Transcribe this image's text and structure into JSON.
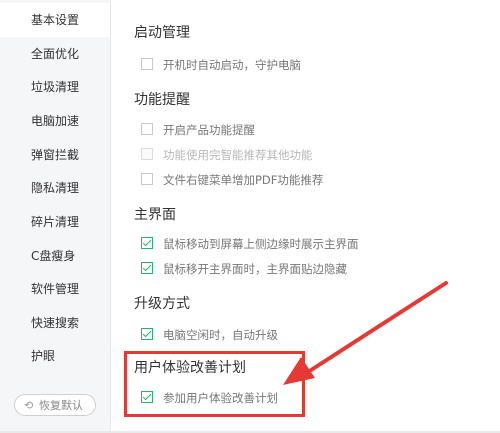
{
  "sidebar": {
    "items": [
      {
        "label": "基本设置"
      },
      {
        "label": "全面优化"
      },
      {
        "label": "垃圾清理"
      },
      {
        "label": "电脑加速"
      },
      {
        "label": "弹窗拦截"
      },
      {
        "label": "隐私清理"
      },
      {
        "label": "碎片清理"
      },
      {
        "label": "C盘瘦身"
      },
      {
        "label": "软件管理"
      },
      {
        "label": "快速搜索"
      },
      {
        "label": "护眼"
      }
    ],
    "restore_button": {
      "icon": "restore-icon",
      "label": "恢复默认"
    }
  },
  "sections": {
    "startup": {
      "title": "启动管理",
      "options": [
        {
          "label": "开机时自动启动，守护电脑",
          "checked": false
        }
      ]
    },
    "reminder": {
      "title": "功能提醒",
      "options": [
        {
          "label": "开启产品功能提醒",
          "checked": false
        },
        {
          "label": "功能使用完智能推荐其他功能",
          "checked": false,
          "disabled": true
        },
        {
          "label": "文件右键菜单增加PDF功能推荐",
          "checked": false
        }
      ]
    },
    "main_ui": {
      "title": "主界面",
      "options": [
        {
          "label": "鼠标移动到屏幕上侧边缘时展示主界面",
          "checked": true
        },
        {
          "label": "鼠标移开主界面时，主界面贴边隐藏",
          "checked": true
        }
      ]
    },
    "upgrade": {
      "title": "升级方式",
      "options": [
        {
          "label": "电脑空闲时，自动升级",
          "checked": true
        }
      ]
    },
    "ux_plan": {
      "title": "用户体验改善计划",
      "options": [
        {
          "label": "参加用户体验改善计划",
          "checked": true
        }
      ]
    }
  },
  "colors": {
    "check_green": "#29b46e",
    "annotation_red": "#e53935",
    "sidebar_bg": "#f5f6f8"
  }
}
